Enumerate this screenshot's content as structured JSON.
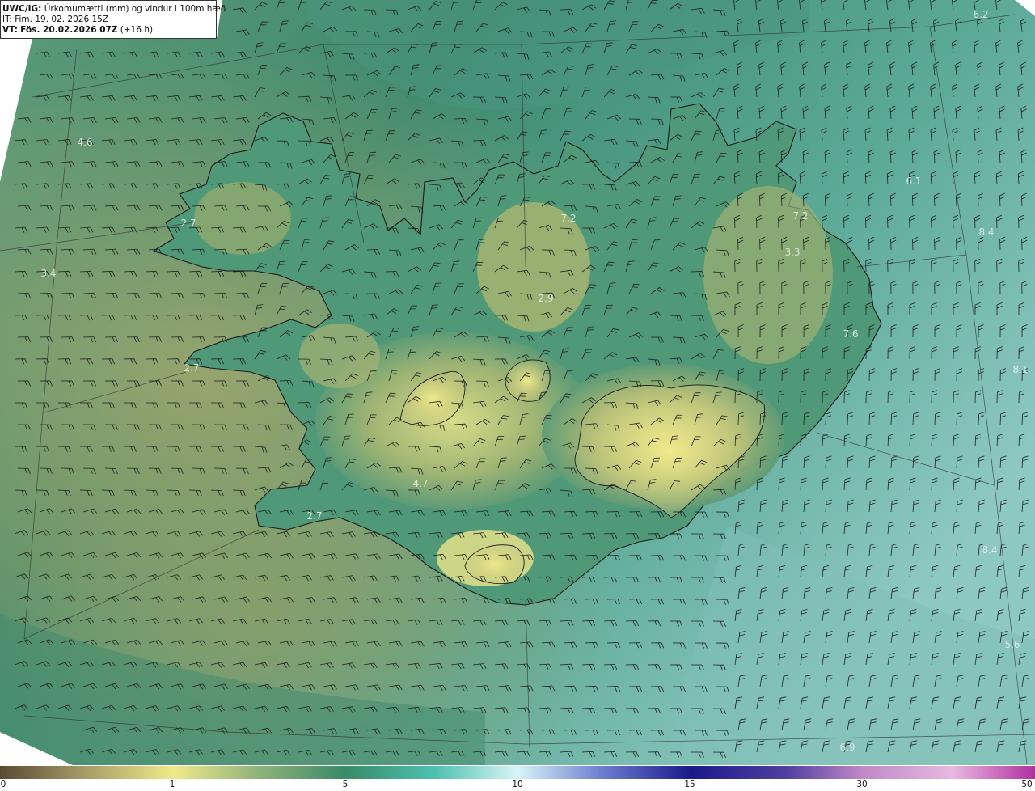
{
  "title": {
    "product": "UWC/IG:",
    "description": "Úrkomumætti (mm) og vindur i 100m hæð",
    "it_line": "IT: Fim. 19. 02. 2026 15Z",
    "vt_prefix": "VT:",
    "vt_bold": "Fös. 20.02.2026 07Z",
    "vt_suffix": "(+16 h)"
  },
  "map_values": [
    "6.2",
    "4.6",
    "6.1",
    "2.7",
    "7.2",
    "7.2",
    "8.4",
    "3.4",
    "3.3",
    "2.9",
    "7.6",
    "2.7",
    "8.1",
    "4.7",
    "2.7",
    "8.4",
    "5.6",
    "6.9"
  ],
  "colorbar": {
    "ticks": [
      "0",
      "1",
      "5",
      "10",
      "15",
      "30",
      "50"
    ],
    "colors": [
      "#5a4a34",
      "#b7a96a",
      "#efe98a",
      "#3a8a68",
      "#4ec0b0",
      "#d8f4f6",
      "#1a1a8a",
      "#5040a0",
      "#e8b8e0",
      "#b030a0"
    ]
  },
  "colors": {
    "low_precip": "#c7c27a",
    "mid_precip": "#3f8a6e",
    "high_precip": "#8ec9c1",
    "coastline": "#1a1a1a",
    "barbs": "#202020"
  }
}
